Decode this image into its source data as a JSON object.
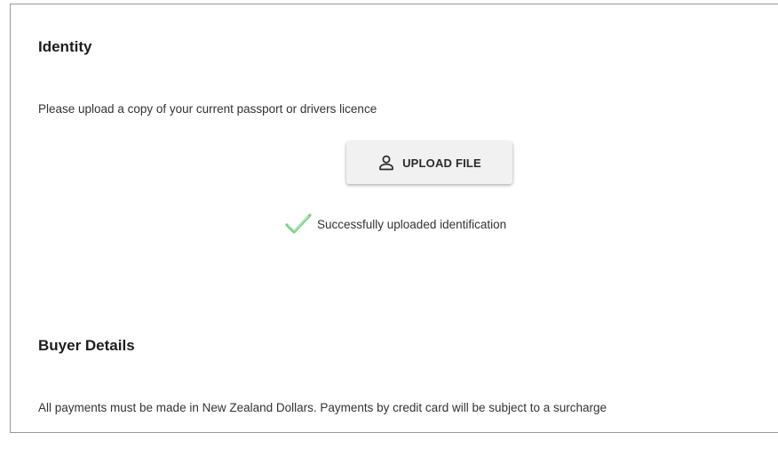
{
  "identity": {
    "title": "Identity",
    "instructions": "Please upload a copy of your current passport or drivers licence",
    "upload_button_label": "UPLOAD FILE",
    "upload_icon": "user-icon",
    "success_icon": "checkmark-icon",
    "success_message": "Successfully uploaded identification"
  },
  "buyer_details": {
    "title": "Buyer Details",
    "notice": "All payments must be made in New Zealand Dollars. Payments by credit card will be subject to a surcharge"
  },
  "colors": {
    "success_check": "#7fcf8a",
    "button_background": "#f1f1f1",
    "panel_border": "#9a9a9a"
  }
}
